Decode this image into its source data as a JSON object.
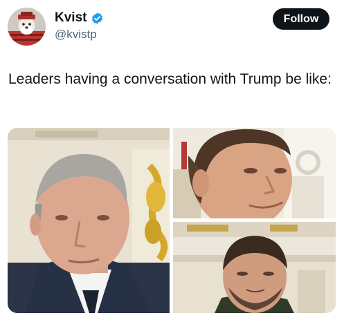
{
  "author": {
    "display_name": "Kvist",
    "handle": "@kvistp",
    "verified_icon": "verified-badge-icon",
    "avatar_icon": "avatar-image"
  },
  "follow_button": {
    "label": "Follow"
  },
  "tweet": {
    "text": "Leaders having a conversation with Trump be like:"
  },
  "media": {
    "images": [
      {
        "name": "media-image-left"
      },
      {
        "name": "media-image-top-right"
      },
      {
        "name": "media-image-bottom-right"
      }
    ]
  },
  "colors": {
    "text_primary": "#0f1419",
    "text_secondary": "#536471",
    "verified_blue": "#1d9bf0",
    "button_bg": "#0f1419"
  }
}
